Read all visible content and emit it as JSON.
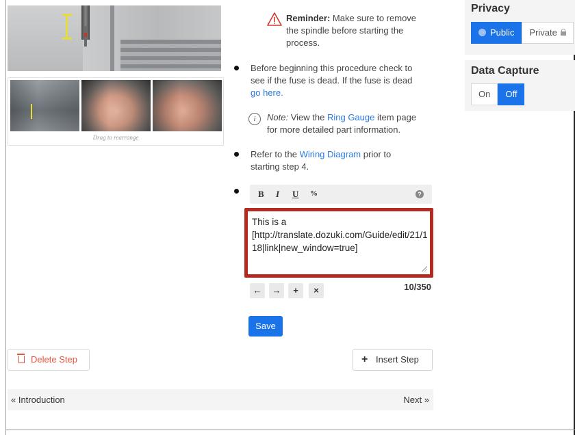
{
  "step": {
    "image_caption": "Drag to rearrange",
    "reminder": {
      "title": "Reminder:",
      "lines": [
        "Make sure to remove",
        "the spindle before starting the",
        "process."
      ]
    },
    "bullet1": {
      "lines": [
        "Before beginning this procedure check to",
        "see if the fuse is dead. If the fuse is dead"
      ],
      "link": "go here."
    },
    "note": {
      "label": "Note:",
      "pre": "View the",
      "link": "Ring Gauge",
      "post": "item page",
      "line2": "for more detailed part information."
    },
    "bullet2": {
      "pre": "Refer to the",
      "link": "Wiring Diagram",
      "post": "prior to",
      "line2": "starting step 4."
    },
    "editor": {
      "toolbar": {
        "bold": "B",
        "italic": "I",
        "underline": "U",
        "link": "%",
        "help": "?"
      },
      "text": "This is a [http://translate.dozuki.com/Guide/edit/21/118|link|new_window=true]",
      "controls": {
        "left": "←",
        "right": "→",
        "add": "+",
        "remove": "×"
      },
      "char_count": "10/350"
    },
    "save_label": "Save",
    "delete_label": "Delete Step",
    "insert_label": "Insert Step"
  },
  "navigation": {
    "prev": "« Introduction",
    "next": "Next »"
  },
  "sidebar": {
    "privacy": {
      "title": "Privacy",
      "options": [
        "Public",
        "Private"
      ],
      "selected": "Public"
    },
    "data_capture": {
      "title": "Data Capture",
      "options": [
        "On",
        "Off"
      ],
      "selected": "Off"
    }
  },
  "colors": {
    "accent": "#1a73e8",
    "link": "#2a7ae2",
    "highlight_border": "#b52a20",
    "danger": "#e5533d"
  }
}
